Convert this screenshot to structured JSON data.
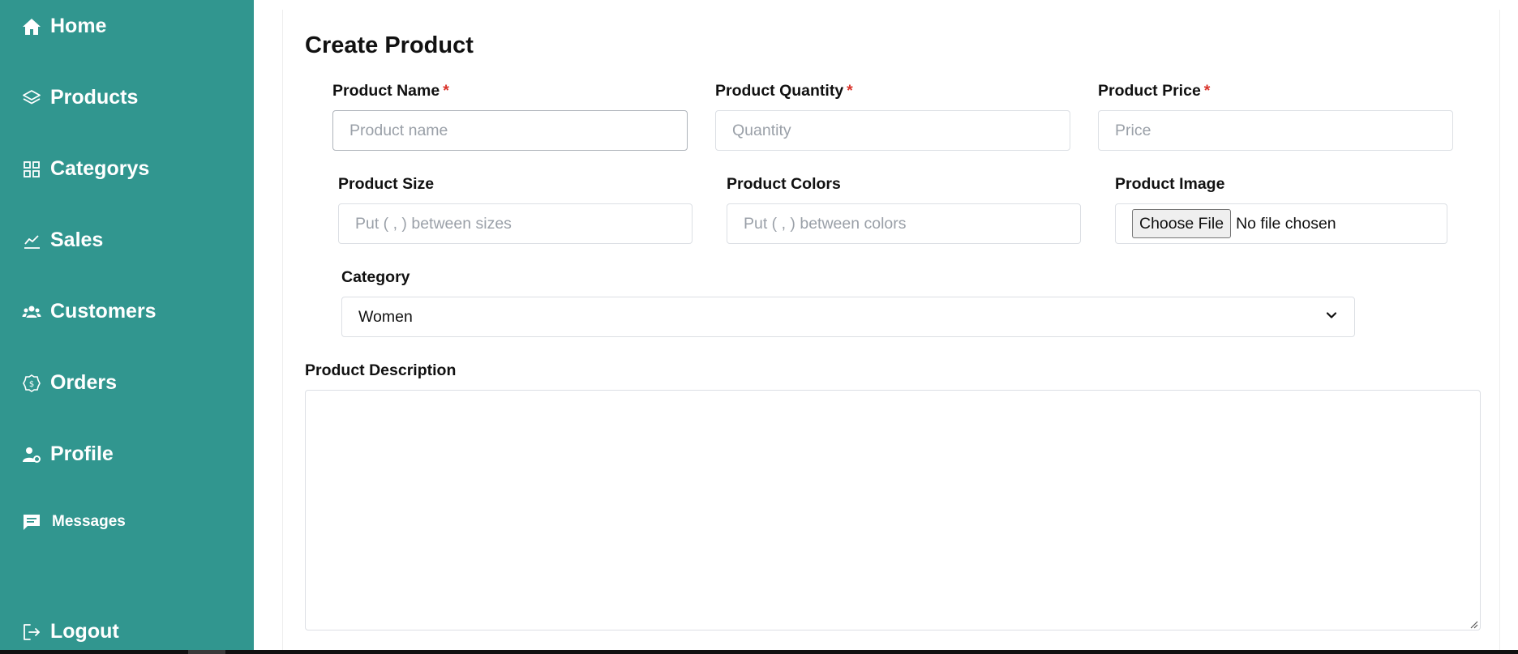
{
  "sidebar": {
    "items": [
      {
        "label": "Home",
        "icon": "home-icon"
      },
      {
        "label": "Products",
        "icon": "layers-icon"
      },
      {
        "label": "Categorys",
        "icon": "grid-icon"
      },
      {
        "label": "Sales",
        "icon": "chart-line-icon"
      },
      {
        "label": "Customers",
        "icon": "users-icon"
      },
      {
        "label": "Orders",
        "icon": "dollar-badge-icon"
      },
      {
        "label": "Profile",
        "icon": "user-gear-icon"
      },
      {
        "label": "Messages",
        "icon": "message-icon"
      },
      {
        "label": "Logout",
        "icon": "logout-icon"
      }
    ],
    "background": "#31968f"
  },
  "form": {
    "title": "Create Product",
    "required_mark": "*",
    "product_name": {
      "label": "Product Name",
      "placeholder": "Product name",
      "value": ""
    },
    "product_quantity": {
      "label": "Product Quantity",
      "placeholder": "Quantity",
      "value": ""
    },
    "product_price": {
      "label": "Product Price",
      "placeholder": "Price",
      "value": ""
    },
    "product_size": {
      "label": "Product Size",
      "placeholder": "Put ( , ) between sizes",
      "value": ""
    },
    "product_colors": {
      "label": "Product Colors",
      "placeholder": "Put ( , ) between colors",
      "value": ""
    },
    "product_image": {
      "label": "Product Image",
      "button": "Choose File",
      "status": "No file chosen"
    },
    "category": {
      "label": "Category",
      "selected": "Women"
    },
    "description": {
      "label": "Product Description",
      "value": ""
    }
  }
}
